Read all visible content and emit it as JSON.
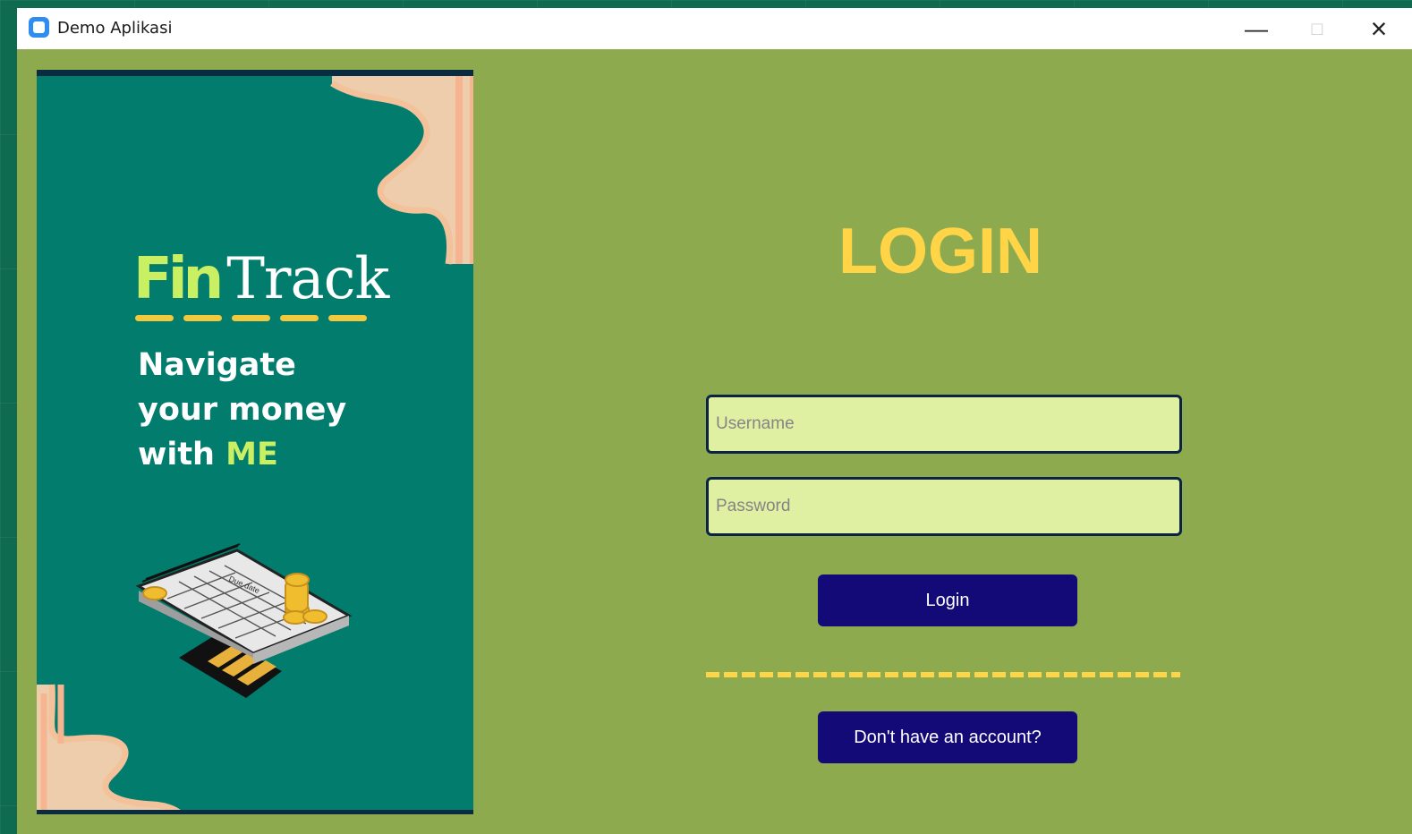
{
  "window": {
    "title": "Demo Aplikasi",
    "controls": {
      "minimize_icon": "minimize-icon",
      "maximize_icon": "maximize-icon",
      "close_icon": "close-icon",
      "minimize_glyph": "—",
      "maximize_glyph": "□",
      "close_glyph": "×"
    }
  },
  "brand": {
    "fin": "Fin",
    "track": "Track"
  },
  "hero": {
    "tagline_line1": "Navigate",
    "tagline_line2": "your money",
    "tagline_line3_prefix": "with ",
    "tagline_line3_accent": "ME",
    "calendar_label": "Due date",
    "illustration_icon": "calendar-coins-chart-icon"
  },
  "login": {
    "title": "LOGIN",
    "username_placeholder": "Username",
    "password_placeholder": "Password",
    "login_button": "Login",
    "signup_button": "Don't have an account?"
  },
  "colors": {
    "window_background": "#8daa4f",
    "card_background": "#017c6d",
    "title_yellow": "#ffd447",
    "input_background": "#dff0a3",
    "button_blue": "#130a78",
    "lime_accent": "#c9ef62"
  }
}
